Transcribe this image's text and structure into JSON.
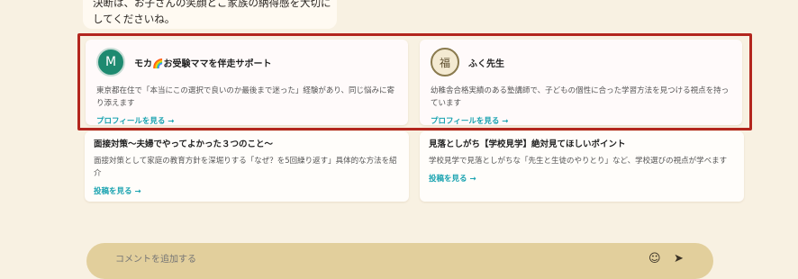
{
  "message": {
    "text": "決断は、お子さんの笑顔とご家族の納得感を大切にしてくださいね。"
  },
  "profiles": [
    {
      "avatar_letter": "M",
      "name": "モカ🌈お受験ママを伴走サポート",
      "description": "東京都在住で「本当にこの選択で良いのか最後まで迷った」経験があり、同じ悩みに寄り添えます",
      "link": "プロフィールを見る →"
    },
    {
      "avatar_letter": "福",
      "name": "ふく先生",
      "description": "幼稚舎合格実績のある塾講師で、子どもの個性に合った学習方法を見つける視点を持っています",
      "link": "プロフィールを見る →"
    }
  ],
  "posts": [
    {
      "title": "面接対策～夫婦でやってよかった３つのこと～",
      "description": "面接対策として家庭の教育方針を深堀りする「なぜ？を5回繰り返す」具体的な方法を紹介",
      "link": "投稿を見る →"
    },
    {
      "title": "見落としがち【学校見学】絶対見てほしいポイント",
      "description": "学校見学で見落としがちな「先生と生徒のやりとり」など、学校選びの視点が学べます",
      "link": "投稿を見る →"
    }
  ],
  "composer": {
    "placeholder": "コメントを追加する",
    "icons": [
      "emoji-icon",
      "send-icon"
    ]
  }
}
